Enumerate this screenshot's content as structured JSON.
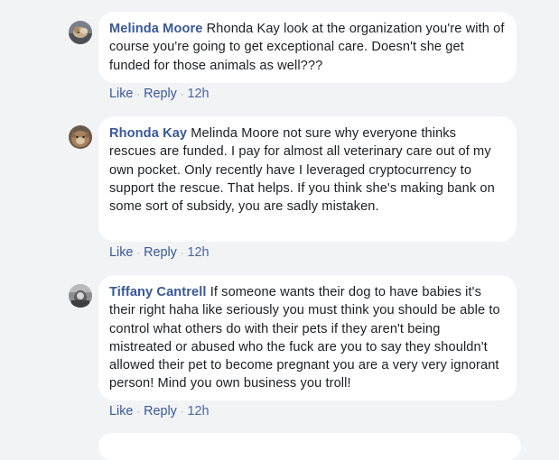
{
  "comments": [
    {
      "author": "Melinda Moore",
      "text": " Rhonda Kay look at the organization you're with of course you're going to get exceptional care. Doesn't she get funded for those animals as well???",
      "like_label": "Like",
      "reply_label": "Reply",
      "separator": "·",
      "timestamp": "12h",
      "avatar_icon": "profile-photo-dog"
    },
    {
      "author": "Rhonda Kay",
      "text": " Melinda Moore not sure why everyone thinks rescues are funded. I pay for almost all veterinary care out of my own pocket. Only recently have I leveraged cryptocurrency to support the rescue. That helps. If you think she's making bank on some sort of subsidy, you are sadly mistaken.",
      "like_label": "Like",
      "reply_label": "Reply",
      "separator": "·",
      "timestamp": "12h",
      "avatar_icon": "profile-photo-cat"
    },
    {
      "author": "Tiffany Cantrell",
      "text": " If someone wants their dog to have babies it's their right haha like seriously you must think you should be able to control what others do with their pets if they aren't being mistreated or abused who the fuck are you to say they shouldn't allowed their pet to become pregnant you are a very very ignorant person! Mind you own business you troll!",
      "like_label": "Like",
      "reply_label": "Reply",
      "separator": "·",
      "timestamp": "12h",
      "avatar_icon": "profile-photo-bw"
    }
  ],
  "colors": {
    "background": "#f2f3f5",
    "bubble": "#ffffff",
    "author": "#385898",
    "text": "#1c1e21",
    "meta": "#90949c"
  }
}
